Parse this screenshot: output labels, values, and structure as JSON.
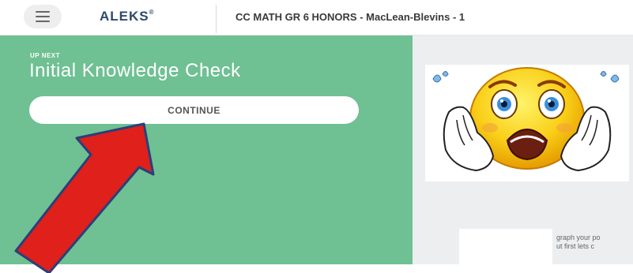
{
  "header": {
    "logo": "ALEKS",
    "logo_mark": "®",
    "course_title": "CC MATH GR 6 HONORS - MacLean-Blevins - 1"
  },
  "main": {
    "up_next_label": "UP NEXT",
    "assessment_title": "Initial Knowledge Check",
    "continue_label": "CONTINUE"
  },
  "side": {
    "partial_text_line1": "graph your po",
    "partial_text_line2": "ut first lets c"
  },
  "colors": {
    "panel_green": "#6fc093",
    "arrow_red": "#e0201b",
    "logo_blue": "#2c4a6b"
  },
  "icons": {
    "menu": "hamburger-icon",
    "emoji": "screaming-face-icon",
    "arrow": "red-arrow-icon"
  }
}
